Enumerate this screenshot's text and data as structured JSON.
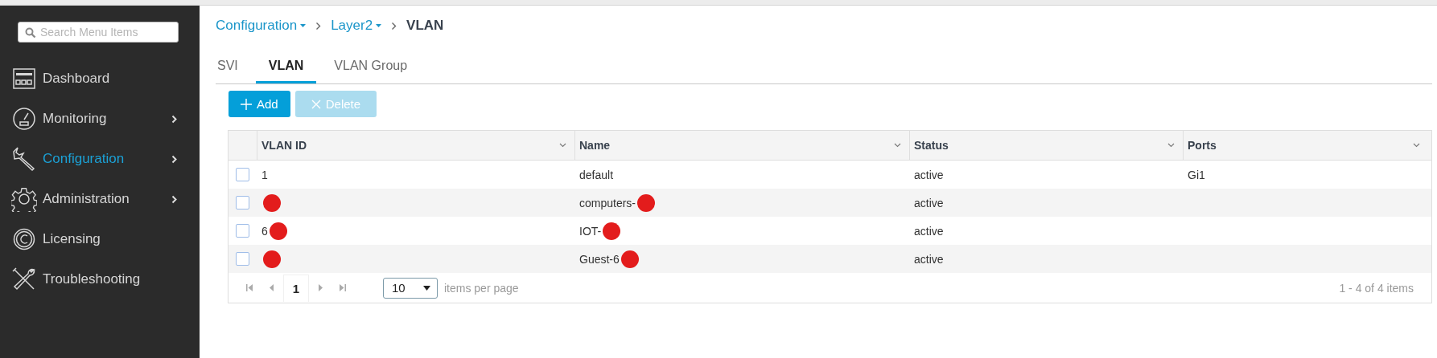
{
  "sidebar": {
    "search": {
      "placeholder": "Search Menu Items"
    },
    "items": [
      {
        "label": "Dashboard",
        "kind": "dashboard",
        "selected": false,
        "submenu": false
      },
      {
        "label": "Monitoring",
        "kind": "monitoring",
        "selected": false,
        "submenu": true
      },
      {
        "label": "Configuration",
        "kind": "configuration",
        "selected": true,
        "submenu": true
      },
      {
        "label": "Administration",
        "kind": "administration",
        "selected": false,
        "submenu": true
      },
      {
        "label": "Licensing",
        "kind": "licensing",
        "selected": false,
        "submenu": false
      },
      {
        "label": "Troubleshooting",
        "kind": "troubleshooting",
        "selected": false,
        "submenu": false
      }
    ]
  },
  "breadcrumb": [
    {
      "label": "Configuration",
      "kind": "link"
    },
    {
      "label": "Layer2",
      "kind": "link"
    },
    {
      "label": "VLAN",
      "kind": "current"
    }
  ],
  "tabs": [
    {
      "label": "SVI",
      "selected": false
    },
    {
      "label": "VLAN",
      "selected": true
    },
    {
      "label": "VLAN Group",
      "selected": false
    }
  ],
  "toolbar": [
    {
      "label": "Add",
      "kind": "add",
      "disabled": false
    },
    {
      "label": "Delete",
      "kind": "delete",
      "disabled": true
    }
  ],
  "table": {
    "columns": [
      "VLAN ID",
      "Name",
      "Status",
      "Ports"
    ],
    "rows": [
      {
        "checked": false,
        "cells": [
          {
            "text": "1"
          },
          {
            "text": "default"
          },
          {
            "text": "active"
          },
          {
            "text": "Gi1"
          }
        ]
      },
      {
        "checked": false,
        "cells": [
          {
            "redacted": true
          },
          {
            "text": "computers-",
            "redacted": true
          },
          {
            "text": "active"
          },
          {}
        ]
      },
      {
        "checked": false,
        "cells": [
          {
            "text": "6",
            "redacted": true
          },
          {
            "text": "IOT-",
            "redacted": true
          },
          {
            "text": "active"
          },
          {}
        ]
      },
      {
        "checked": false,
        "cells": [
          {
            "redacted": true
          },
          {
            "text": "Guest-6",
            "redacted": true
          },
          {
            "text": "active"
          },
          {}
        ]
      }
    ]
  },
  "pager": {
    "page": "1",
    "page_size": "10",
    "page_size_label": "items per page",
    "summary": "1 - 4 of 4 items"
  }
}
